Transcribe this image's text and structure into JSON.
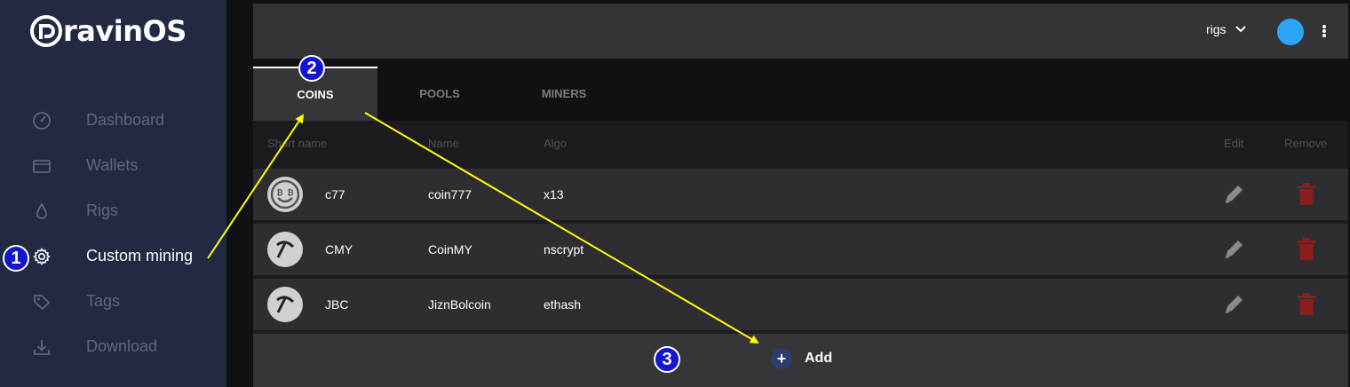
{
  "app": {
    "logo_text": "ravinOS"
  },
  "sidebar": {
    "items": [
      {
        "label": "Dashboard",
        "icon": "speedometer-icon"
      },
      {
        "label": "Wallets",
        "icon": "wallet-icon"
      },
      {
        "label": "Rigs",
        "icon": "drop-icon"
      },
      {
        "label": "Custom mining",
        "icon": "gear-icon",
        "active": true
      },
      {
        "label": "Tags",
        "icon": "tag-icon"
      },
      {
        "label": "Download",
        "icon": "download-icon"
      }
    ]
  },
  "topbar": {
    "rigs_label": "rigs",
    "avatar_color": "#2aa4f4"
  },
  "tabs": [
    {
      "label": "COINS",
      "active": true
    },
    {
      "label": "POOLS"
    },
    {
      "label": "MINERS"
    }
  ],
  "table": {
    "headers": {
      "short_name": "Short name",
      "name": "Name",
      "algo": "Algo",
      "edit": "Edit",
      "remove": "Remove"
    },
    "rows": [
      {
        "short": "c77",
        "name": "coin777",
        "algo": "x13",
        "icon": "bitcoin-face-icon"
      },
      {
        "short": "CMY",
        "name": "CoinMY",
        "algo": "nscrypt",
        "icon": "pickaxe-icon"
      },
      {
        "short": "JBC",
        "name": "JiznBolcoin",
        "algo": "ethash",
        "icon": "pickaxe-icon"
      }
    ]
  },
  "add": {
    "label": "Add",
    "symbol": "+"
  },
  "annotations": {
    "m1": "1",
    "m2": "2",
    "m3": "3",
    "arrow_color": "#ffff00"
  },
  "colors": {
    "sidebar": "#222a43",
    "remove": "#8b1d1d",
    "marker": "#1515d0"
  }
}
